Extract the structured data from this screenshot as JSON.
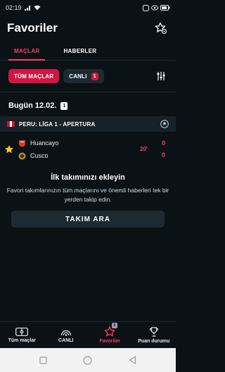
{
  "status_bar": {
    "time": "02:19",
    "indicators": [
      "signal-icon",
      "wifi-icon",
      "nfc-icon",
      "battery-icon"
    ]
  },
  "header": {
    "title": "Favoriler"
  },
  "tabs": [
    {
      "label": "MAÇLAR",
      "active": true
    },
    {
      "label": "HABERLER",
      "active": false
    }
  ],
  "filters": {
    "all_label": "TÜM MAÇLAR",
    "live_label": "CANLI",
    "live_count": "1"
  },
  "date_section": {
    "label": "Bugün 12.02.",
    "count": "1"
  },
  "league": {
    "country": "PERU:",
    "name": "LİGA 1 - APERTURA"
  },
  "match": {
    "home": "Huancayo",
    "away": "Cusco",
    "home_score": "0",
    "away_score": "0",
    "minute": "20'"
  },
  "empty_state": {
    "title": "İlk takımınızı ekleyin",
    "description": "Favori takımlarınızın tüm maçlarını ve önemli haberleri tek bir yerden takip edin.",
    "cta_label": "TAKIM ARA"
  },
  "bottom_nav": [
    {
      "label": "Tüm maçlar",
      "icon": "pitch-icon"
    },
    {
      "label": "CANLI",
      "icon": "live-icon"
    },
    {
      "label": "Favoriler",
      "icon": "star-icon",
      "badge": "1"
    },
    {
      "label": "Puan durumu",
      "icon": "trophy-icon"
    }
  ],
  "colors": {
    "accent": "#ff3a6a",
    "background": "#0b1215",
    "surface": "#1c2a31",
    "favorite": "#f5c518"
  }
}
